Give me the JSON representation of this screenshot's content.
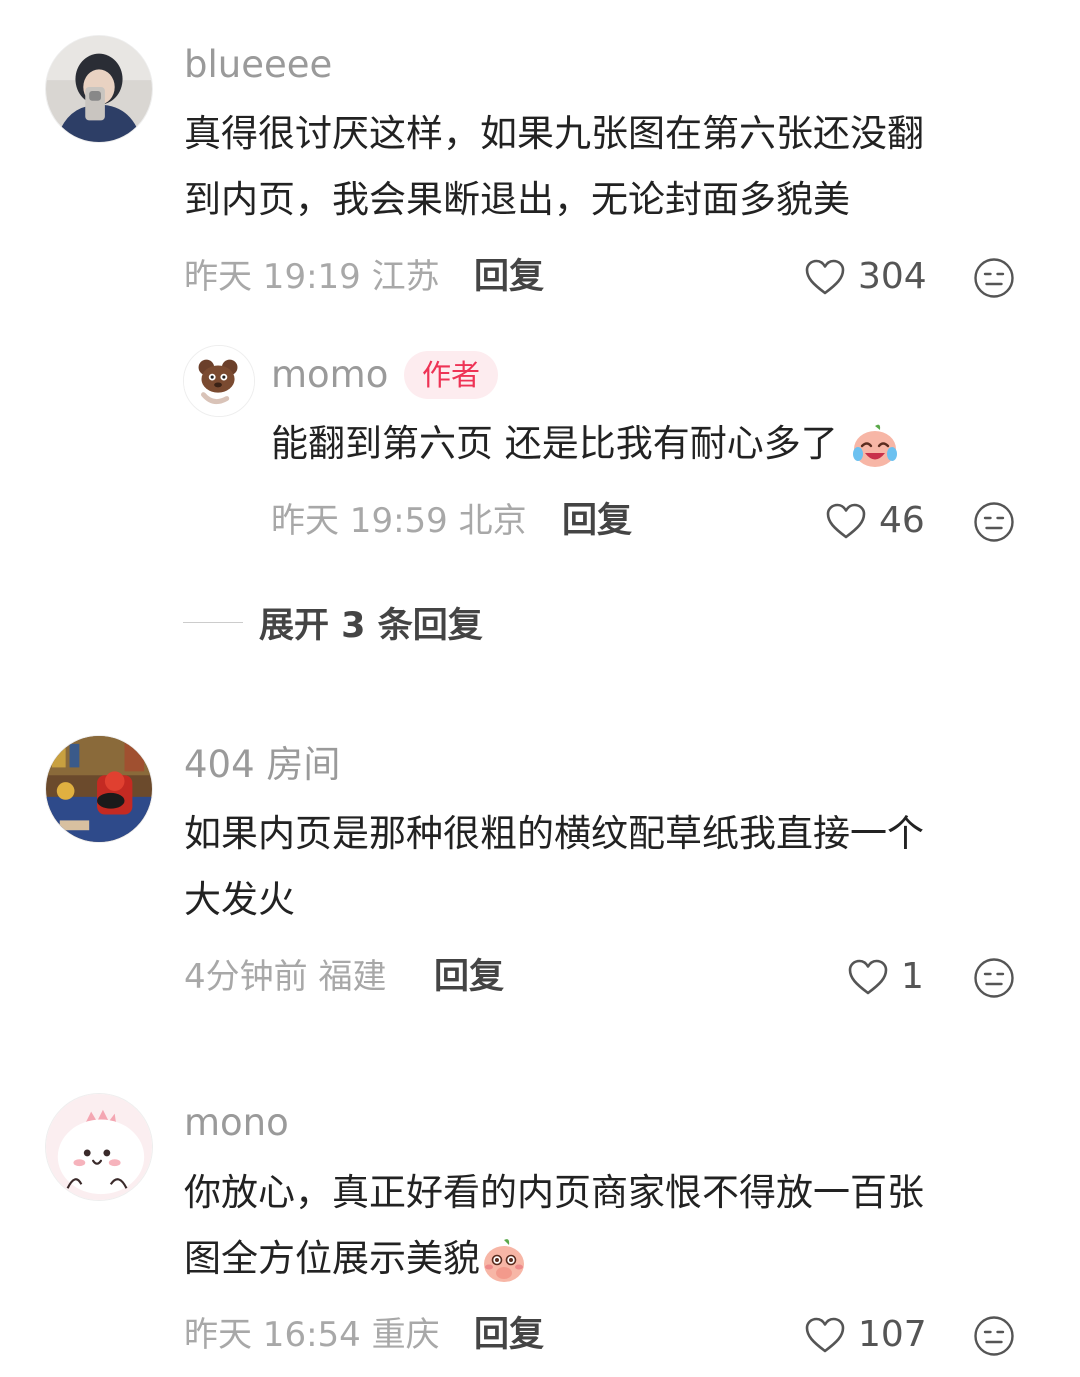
{
  "comments": [
    {
      "username": "blueeee",
      "text_lines": [
        "真得很讨厌这样，如果九张图在第六张还没翻",
        "到内页，我会果断退出，无论封面多貌美"
      ],
      "time": "昨天 19:19",
      "location": "江苏",
      "reply_label": "回复",
      "likes": "304",
      "avatar_icon": "user-photo-avatar",
      "replies": [
        {
          "username": "momo",
          "badge": "作者",
          "text": "能翻到第六页 还是比我有耐心多了",
          "emoji": "laugh-cry-emoji",
          "time": "昨天 19:59",
          "location": "北京",
          "reply_label": "回复",
          "likes": "46",
          "avatar_icon": "bear-sticker-avatar"
        }
      ],
      "expand_label": "展开 3 条回复"
    },
    {
      "username": "404 房间",
      "text_lines": [
        "如果内页是那种很粗的横纹配草纸我直接一个",
        "大发火"
      ],
      "time": "4分钟前",
      "location": "福建",
      "reply_label": "回复",
      "likes": "1",
      "avatar_icon": "illustrated-room-avatar"
    },
    {
      "username": "mono",
      "text_lines": [
        "你放心，真正好看的内页商家恨不得放一百张",
        "图全方位展示美貌"
      ],
      "emoji": "shy-emoji",
      "time": "昨天 16:54",
      "location": "重庆",
      "reply_label": "回复",
      "likes": "107",
      "avatar_icon": "pink-dino-avatar"
    }
  ],
  "colors": {
    "username": "#9a9a9a",
    "text": "#222222",
    "meta": "#a8a8a8",
    "badge_text": "#ee3355",
    "badge_bg": "#fdecef"
  }
}
